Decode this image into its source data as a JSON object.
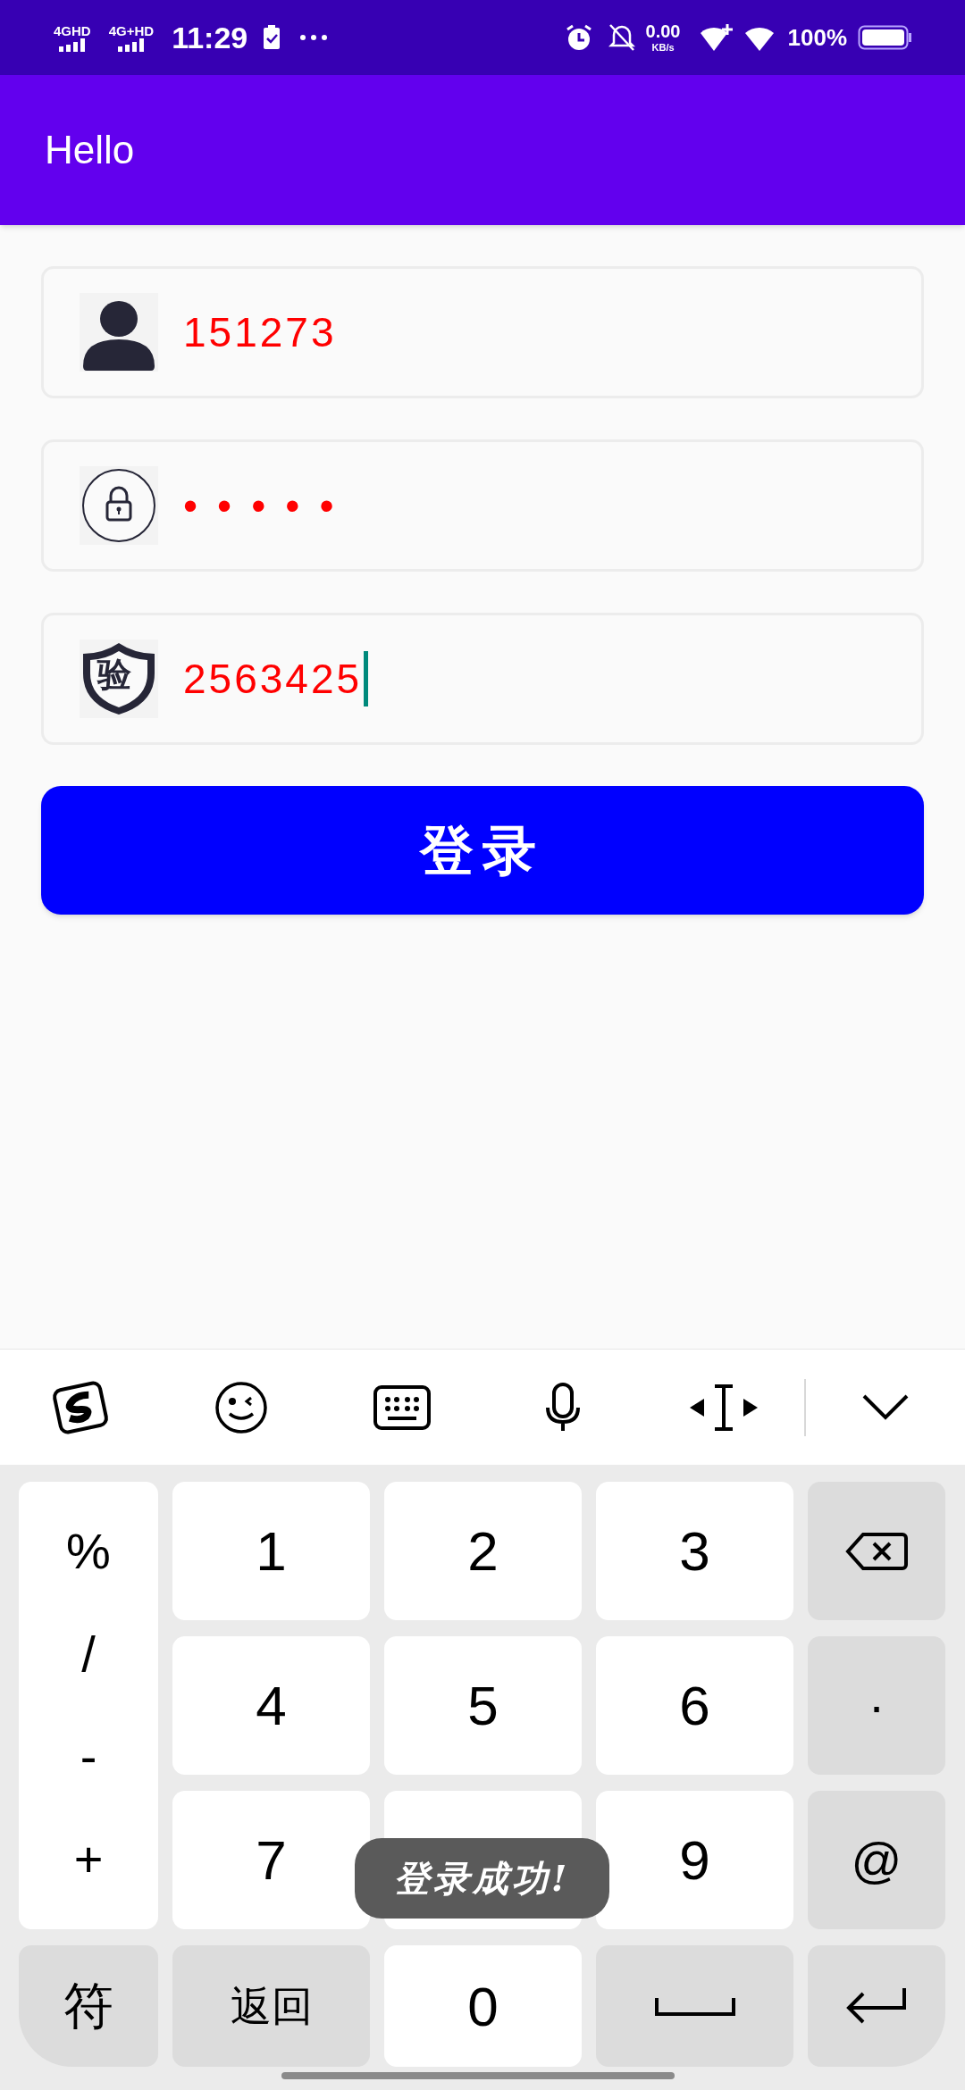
{
  "status_bar": {
    "networks": [
      "4GHD",
      "4G+HD"
    ],
    "time": "11:29",
    "speed": "0.00",
    "speed_unit": "KB/s",
    "battery": "100%"
  },
  "app_bar": {
    "title": "Hello"
  },
  "fields": [
    {
      "kind": "user",
      "value": "151273",
      "focused": false
    },
    {
      "kind": "password",
      "value": "•••••",
      "focused": false
    },
    {
      "kind": "code",
      "badge": "验",
      "value": "2563425",
      "focused": true
    }
  ],
  "login_button": {
    "label": "登录"
  },
  "keyboard": {
    "symbols": [
      "%",
      "/",
      "-",
      "+"
    ],
    "keys": [
      {
        "kind": "digit",
        "label": "1"
      },
      {
        "kind": "digit",
        "label": "2"
      },
      {
        "kind": "digit",
        "label": "3"
      },
      {
        "kind": "backspace"
      },
      {
        "kind": "digit",
        "label": "4"
      },
      {
        "kind": "digit",
        "label": "5"
      },
      {
        "kind": "digit",
        "label": "6"
      },
      {
        "kind": "function",
        "label": "·"
      },
      {
        "kind": "digit",
        "label": "7"
      },
      {
        "kind": "digit"
      },
      {
        "kind": "digit",
        "label": "9"
      },
      {
        "kind": "function",
        "label": "@"
      },
      {
        "kind": "function",
        "label": "符"
      },
      {
        "kind": "function",
        "label": "返回"
      },
      {
        "kind": "digit",
        "label": "0"
      },
      {
        "kind": "space"
      },
      {
        "kind": "enter"
      }
    ]
  },
  "toast": {
    "text": "登录成功!"
  }
}
